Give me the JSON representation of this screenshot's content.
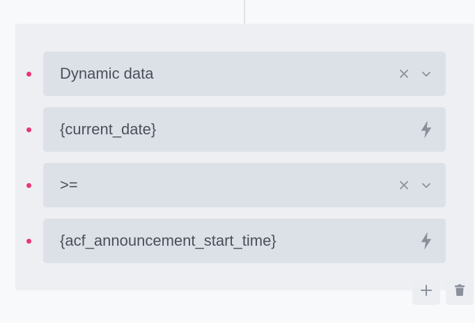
{
  "conditions": [
    {
      "value": "Dynamic data",
      "control": "select"
    },
    {
      "value": "{current_date}",
      "control": "dynamic"
    },
    {
      "value": ">=",
      "control": "select"
    },
    {
      "value": "{acf_announcement_start_time}",
      "control": "dynamic"
    }
  ],
  "actions": {
    "add_icon": "plus-icon",
    "delete_icon": "trash-icon"
  },
  "colors": {
    "bullet": "#e8357a",
    "field_bg": "#dce1e8",
    "panel_bg": "#eeeff3",
    "icon": "#8a909a"
  }
}
